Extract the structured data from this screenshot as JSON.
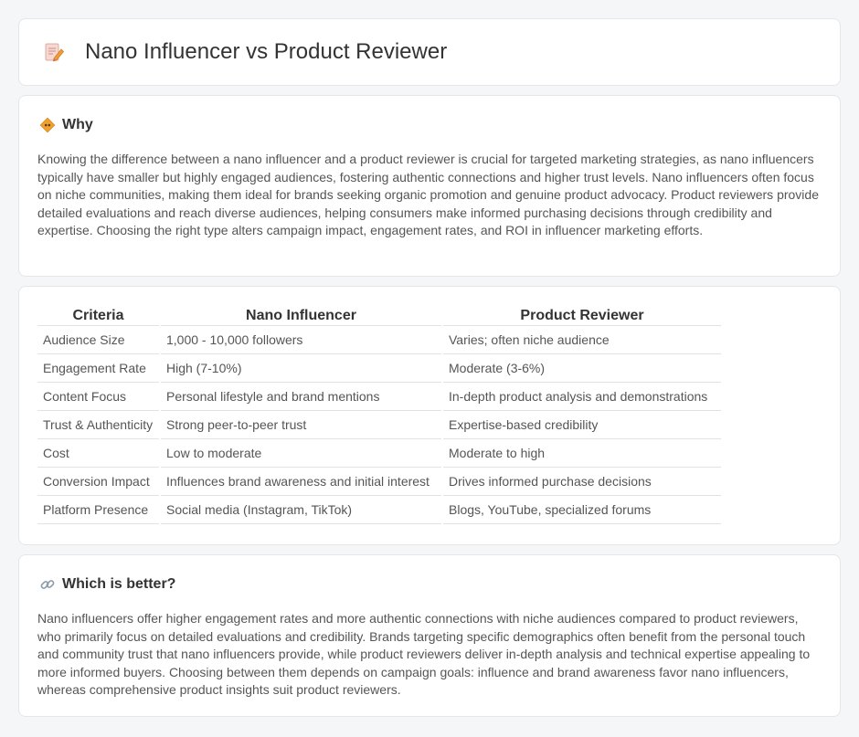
{
  "header": {
    "title": "Nano Influencer vs Product Reviewer",
    "icon": "pencil-memo-icon"
  },
  "why": {
    "icon": "diamond-sign-icon",
    "title": "Why",
    "text": "Knowing the difference between a nano influencer and a product reviewer is crucial for targeted marketing strategies, as nano influencers typically have smaller but highly engaged audiences, fostering authentic connections and higher trust levels. Nano influencers often focus on niche communities, making them ideal for brands seeking organic promotion and genuine product advocacy. Product reviewers provide detailed evaluations and reach diverse audiences, helping consumers make informed purchasing decisions through credibility and expertise. Choosing the right type alters campaign impact, engagement rates, and ROI in influencer marketing efforts."
  },
  "table": {
    "headers": [
      "Criteria",
      "Nano Influencer",
      "Product Reviewer"
    ],
    "rows": [
      [
        "Audience Size",
        "1,000 - 10,000 followers",
        "Varies; often niche audience"
      ],
      [
        "Engagement Rate",
        "High (7-10%)",
        "Moderate (3-6%)"
      ],
      [
        "Content Focus",
        "Personal lifestyle and brand mentions",
        "In-depth product analysis and demonstrations"
      ],
      [
        "Trust & Authenticity",
        "Strong peer-to-peer trust",
        "Expertise-based credibility"
      ],
      [
        "Cost",
        "Low to moderate",
        "Moderate to high"
      ],
      [
        "Conversion Impact",
        "Influences brand awareness and initial interest",
        "Drives informed purchase decisions"
      ],
      [
        "Platform Presence",
        "Social media (Instagram, TikTok)",
        "Blogs, YouTube, specialized forums"
      ]
    ]
  },
  "better": {
    "icon": "link-icon",
    "title": "Which is better?",
    "text": "Nano influencers offer higher engagement rates and more authentic connections with niche audiences compared to product reviewers, who primarily focus on detailed evaluations and credibility. Brands targeting specific demographics often benefit from the personal touch and community trust that nano influencers provide, while product reviewers deliver in-depth analysis and technical expertise appealing to more informed buyers. Choosing between them depends on campaign goals: influence and brand awareness favor nano influencers, whereas comprehensive product insights suit product reviewers."
  },
  "colors": {
    "background": "#f5f6f8",
    "card": "#ffffff",
    "accent_orange": "#f0a030",
    "icon_red": "#e0605a"
  }
}
